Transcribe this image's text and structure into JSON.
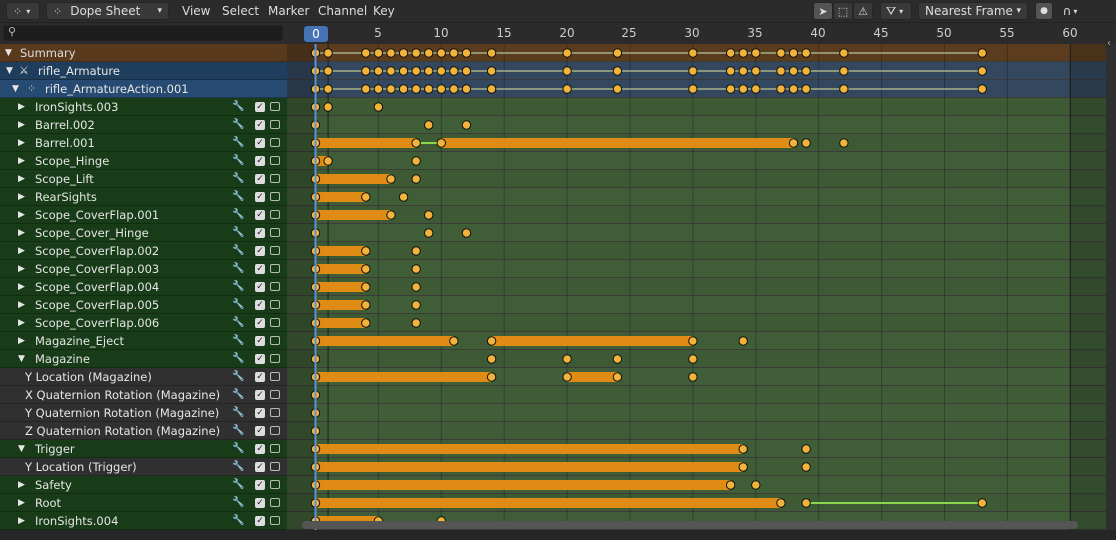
{
  "header": {
    "editor_type_icon": "dopesheet-icon",
    "mode_icon": "dopesheet-icon",
    "mode_label": "Dope Sheet",
    "menus": [
      "View",
      "Select",
      "Marker",
      "Channel",
      "Key"
    ],
    "snap_label": "Nearest Frame"
  },
  "ruler": {
    "current_frame": "0",
    "ticks": [
      "5",
      "10",
      "15",
      "20",
      "25",
      "30",
      "35",
      "40",
      "45",
      "50",
      "55",
      "60"
    ]
  },
  "colors": {
    "summary_bg": "#5a3a1d",
    "object_bg": "#1f3e5e",
    "action_bg": "#264a71",
    "group_bg": "#183b18",
    "fcurve_bg": "#303030",
    "key_fill": "#f2b33a",
    "hold_bar": "#e08c14",
    "hold_line": "#8ad64a",
    "playhead": "#5b93d6"
  },
  "channels": [
    {
      "label": "Summary",
      "kind": "summary",
      "expander": "down"
    },
    {
      "label": "rifle_Armature",
      "kind": "object",
      "expander": "down"
    },
    {
      "label": "rifle_ArmatureAction.001",
      "kind": "action",
      "expander": "down"
    },
    {
      "label": "IronSights.003",
      "kind": "group",
      "expander": "right"
    },
    {
      "label": "Barrel.002",
      "kind": "group",
      "expander": "right"
    },
    {
      "label": "Barrel.001",
      "kind": "group",
      "expander": "right"
    },
    {
      "label": "Scope_Hinge",
      "kind": "group",
      "expander": "right"
    },
    {
      "label": "Scope_Lift",
      "kind": "group",
      "expander": "right"
    },
    {
      "label": "RearSights",
      "kind": "group",
      "expander": "right"
    },
    {
      "label": "Scope_CoverFlap.001",
      "kind": "group",
      "expander": "right"
    },
    {
      "label": "Scope_Cover_Hinge",
      "kind": "group",
      "expander": "right"
    },
    {
      "label": "Scope_CoverFlap.002",
      "kind": "group",
      "expander": "right"
    },
    {
      "label": "Scope_CoverFlap.003",
      "kind": "group",
      "expander": "right"
    },
    {
      "label": "Scope_CoverFlap.004",
      "kind": "group",
      "expander": "right"
    },
    {
      "label": "Scope_CoverFlap.005",
      "kind": "group",
      "expander": "right"
    },
    {
      "label": "Scope_CoverFlap.006",
      "kind": "group",
      "expander": "right"
    },
    {
      "label": "Magazine_Eject",
      "kind": "group",
      "expander": "right"
    },
    {
      "label": "Magazine",
      "kind": "group",
      "expander": "down"
    },
    {
      "label": "Y Location (Magazine)",
      "kind": "fcurve",
      "expander": ""
    },
    {
      "label": "X Quaternion Rotation (Magazine)",
      "kind": "fcurve",
      "expander": ""
    },
    {
      "label": "Y Quaternion Rotation (Magazine)",
      "kind": "fcurve",
      "expander": ""
    },
    {
      "label": "Z Quaternion Rotation (Magazine)",
      "kind": "fcurve",
      "expander": ""
    },
    {
      "label": "Trigger",
      "kind": "group",
      "expander": "down"
    },
    {
      "label": "Y Location (Trigger)",
      "kind": "fcurve",
      "expander": ""
    },
    {
      "label": "Safety",
      "kind": "group",
      "expander": "right"
    },
    {
      "label": "Root",
      "kind": "group",
      "expander": "right"
    },
    {
      "label": "IronSights.004",
      "kind": "group",
      "expander": "right"
    }
  ],
  "keyframes": [
    {
      "keys": [
        0,
        1,
        4,
        5,
        6,
        7,
        8,
        9,
        10,
        11,
        12,
        14,
        20,
        24,
        30,
        33,
        34,
        35,
        37,
        38,
        39,
        42,
        53
      ],
      "holds": [],
      "lines": []
    },
    {
      "keys": [
        0,
        1,
        4,
        5,
        6,
        7,
        8,
        9,
        10,
        11,
        12,
        14,
        20,
        24,
        30,
        33,
        34,
        35,
        37,
        38,
        39,
        42,
        53
      ],
      "holds": [],
      "lines": []
    },
    {
      "keys": [
        0,
        1,
        4,
        5,
        6,
        7,
        8,
        9,
        10,
        11,
        12,
        14,
        20,
        24,
        30,
        33,
        34,
        35,
        37,
        38,
        39,
        42,
        53
      ],
      "holds": [],
      "lines": []
    },
    {
      "keys": [
        0,
        1,
        5
      ],
      "holds": [],
      "lines": []
    },
    {
      "keys": [
        0,
        9,
        12
      ],
      "holds": [],
      "lines": []
    },
    {
      "keys": [
        0,
        8,
        10,
        38,
        39,
        42
      ],
      "holds": [
        [
          0,
          8
        ],
        [
          10,
          38
        ]
      ],
      "lines": [
        [
          8,
          10
        ]
      ]
    },
    {
      "keys": [
        0,
        1,
        8
      ],
      "holds": [
        [
          0,
          1
        ]
      ],
      "lines": []
    },
    {
      "keys": [
        0,
        6,
        8
      ],
      "holds": [
        [
          0,
          6
        ]
      ],
      "lines": []
    },
    {
      "keys": [
        0,
        4,
        7
      ],
      "holds": [
        [
          0,
          4
        ]
      ],
      "lines": []
    },
    {
      "keys": [
        0,
        6,
        9
      ],
      "holds": [
        [
          0,
          6
        ]
      ],
      "lines": []
    },
    {
      "keys": [
        0,
        9,
        12
      ],
      "holds": [],
      "lines": []
    },
    {
      "keys": [
        0,
        4,
        8
      ],
      "holds": [
        [
          0,
          4
        ]
      ],
      "lines": []
    },
    {
      "keys": [
        0,
        4,
        8
      ],
      "holds": [
        [
          0,
          4
        ]
      ],
      "lines": []
    },
    {
      "keys": [
        0,
        4,
        8
      ],
      "holds": [
        [
          0,
          4
        ]
      ],
      "lines": []
    },
    {
      "keys": [
        0,
        4,
        8
      ],
      "holds": [
        [
          0,
          4
        ]
      ],
      "lines": []
    },
    {
      "keys": [
        0,
        4,
        8
      ],
      "holds": [
        [
          0,
          4
        ]
      ],
      "lines": []
    },
    {
      "keys": [
        0,
        11,
        14,
        30,
        34
      ],
      "holds": [
        [
          0,
          11
        ],
        [
          14,
          30
        ]
      ],
      "lines": []
    },
    {
      "keys": [
        0,
        14,
        20,
        24,
        30
      ],
      "holds": [],
      "lines": []
    },
    {
      "keys": [
        0,
        14,
        20,
        24,
        30
      ],
      "holds": [
        [
          0,
          14
        ],
        [
          20,
          24
        ]
      ],
      "lines": []
    },
    {
      "keys": [
        0
      ],
      "holds": [],
      "lines": []
    },
    {
      "keys": [
        0
      ],
      "holds": [],
      "lines": []
    },
    {
      "keys": [
        0
      ],
      "holds": [],
      "lines": []
    },
    {
      "keys": [
        0,
        34,
        39
      ],
      "holds": [
        [
          0,
          34
        ]
      ],
      "lines": []
    },
    {
      "keys": [
        0,
        34,
        39
      ],
      "holds": [
        [
          0,
          34
        ]
      ],
      "lines": []
    },
    {
      "keys": [
        0,
        33,
        35
      ],
      "holds": [
        [
          0,
          33
        ]
      ],
      "lines": []
    },
    {
      "keys": [
        0,
        37,
        39,
        53
      ],
      "holds": [
        [
          0,
          37
        ]
      ],
      "lines": [
        [
          39,
          53
        ]
      ]
    },
    {
      "keys": [
        0,
        5,
        10
      ],
      "holds": [
        [
          0,
          5
        ]
      ],
      "lines": []
    }
  ]
}
